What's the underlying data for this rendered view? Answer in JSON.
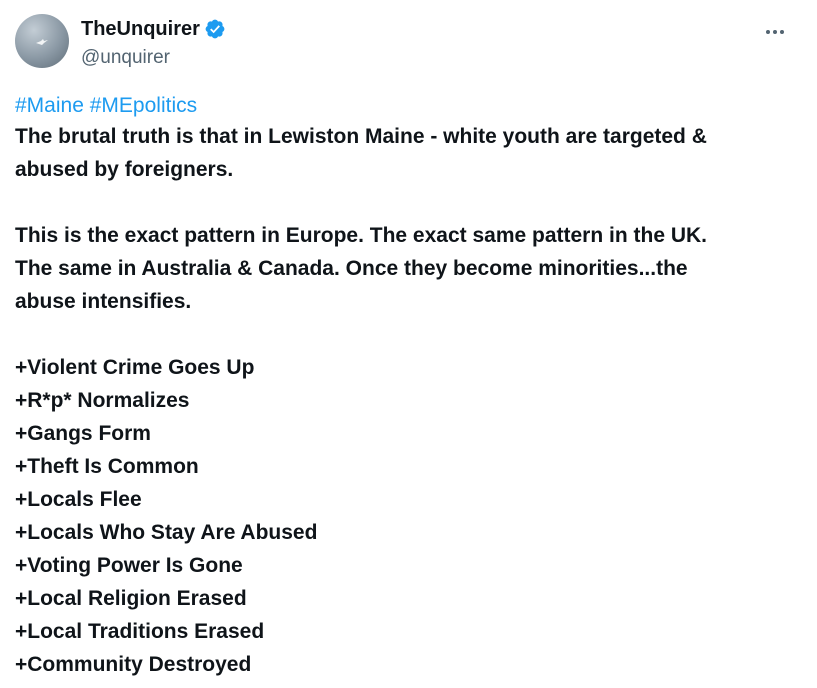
{
  "author": {
    "display_name": "TheUnquirer",
    "handle": "@unquirer"
  },
  "hashtags": [
    "#Maine",
    "#MEpolitics"
  ],
  "paragraphs": [
    [
      "The brutal truth is that in Lewiston Maine - white youth are targeted &",
      "abused by foreigners."
    ],
    [
      "This is the exact pattern in Europe.  The exact same pattern in the UK.",
      "The same in Australia & Canada.  Once they become minorities...the",
      "abuse intensifies."
    ]
  ],
  "list_items": [
    "+Violent Crime Goes Up",
    "+R*p* Normalizes",
    "+Gangs Form",
    "+Theft Is Common",
    "+Locals Flee",
    "+Locals Who Stay Are Abused",
    "+Voting Power Is Gone",
    "+Local Religion Erased",
    "+Local Traditions Erased",
    "+Community Destroyed"
  ],
  "colors": {
    "link": "#1d9bf0",
    "text": "#0f1419",
    "secondary": "#536471",
    "verified": "#1d9bf0"
  },
  "icons": {
    "verified": "verified-badge-icon",
    "more": "more-options-icon"
  }
}
